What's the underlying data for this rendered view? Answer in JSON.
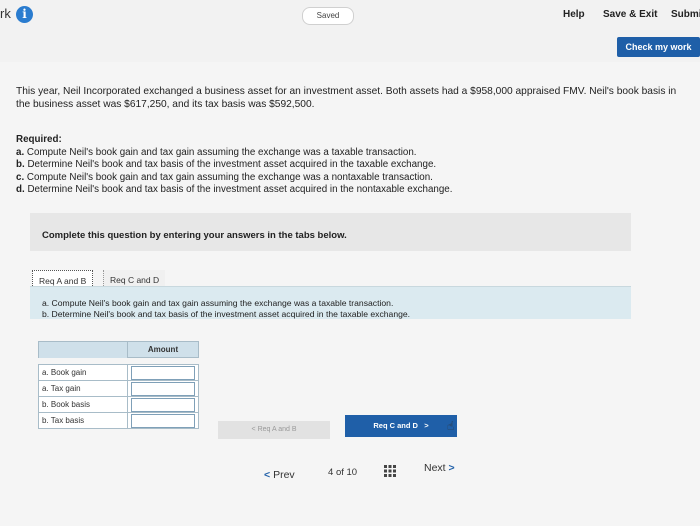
{
  "topbar": {
    "brand": "rk",
    "info_icon": "i",
    "saved": "Saved",
    "help": "Help",
    "save_exit": "Save & Exit",
    "submit": "Submi"
  },
  "check_work": "Check my work",
  "intro": "This year, Neil Incorporated exchanged a business asset for an investment asset. Both assets had a $958,000 appraised FMV. Neil's book basis in the business asset was $617,250, and its tax basis was $592,500.",
  "required": {
    "header": "Required:",
    "items": [
      {
        "letter": "a.",
        "text": "Compute Neil's book gain and tax gain assuming the exchange was a taxable transaction."
      },
      {
        "letter": "b.",
        "text": "Determine Neil's book and tax basis of the investment asset acquired in the taxable exchange."
      },
      {
        "letter": "c.",
        "text": "Compute Neil's book gain and tax gain assuming the exchange was a nontaxable transaction."
      },
      {
        "letter": "d.",
        "text": "Determine Neil's book and tax basis of the investment asset acquired in the nontaxable exchange."
      }
    ]
  },
  "complete_text": "Complete this question by entering your answers in the tabs below.",
  "tabs": [
    {
      "label": "Req A and B"
    },
    {
      "label": "Req C and D"
    }
  ],
  "question_lines": [
    "a. Compute Neil's book gain and tax gain assuming the exchange was a taxable transaction.",
    "b. Determine Neil's book and tax basis of the investment asset acquired in the taxable exchange."
  ],
  "table": {
    "header": "Amount",
    "rows": [
      {
        "label": "a. Book gain",
        "value": ""
      },
      {
        "label": "a. Tax gain",
        "value": ""
      },
      {
        "label": "b. Book basis",
        "value": ""
      },
      {
        "label": "b. Tax basis",
        "value": ""
      }
    ]
  },
  "nav": {
    "prev_tab": "Req A and B",
    "next_tab": "Req C and D",
    "prev_page": "Prev",
    "page_current": "4",
    "page_of": "of",
    "page_total": "10",
    "next_page": "Next"
  },
  "colors": {
    "accent": "#1f5fa8",
    "info": "#2a7ccf",
    "question_bg": "#dbeaf0"
  }
}
